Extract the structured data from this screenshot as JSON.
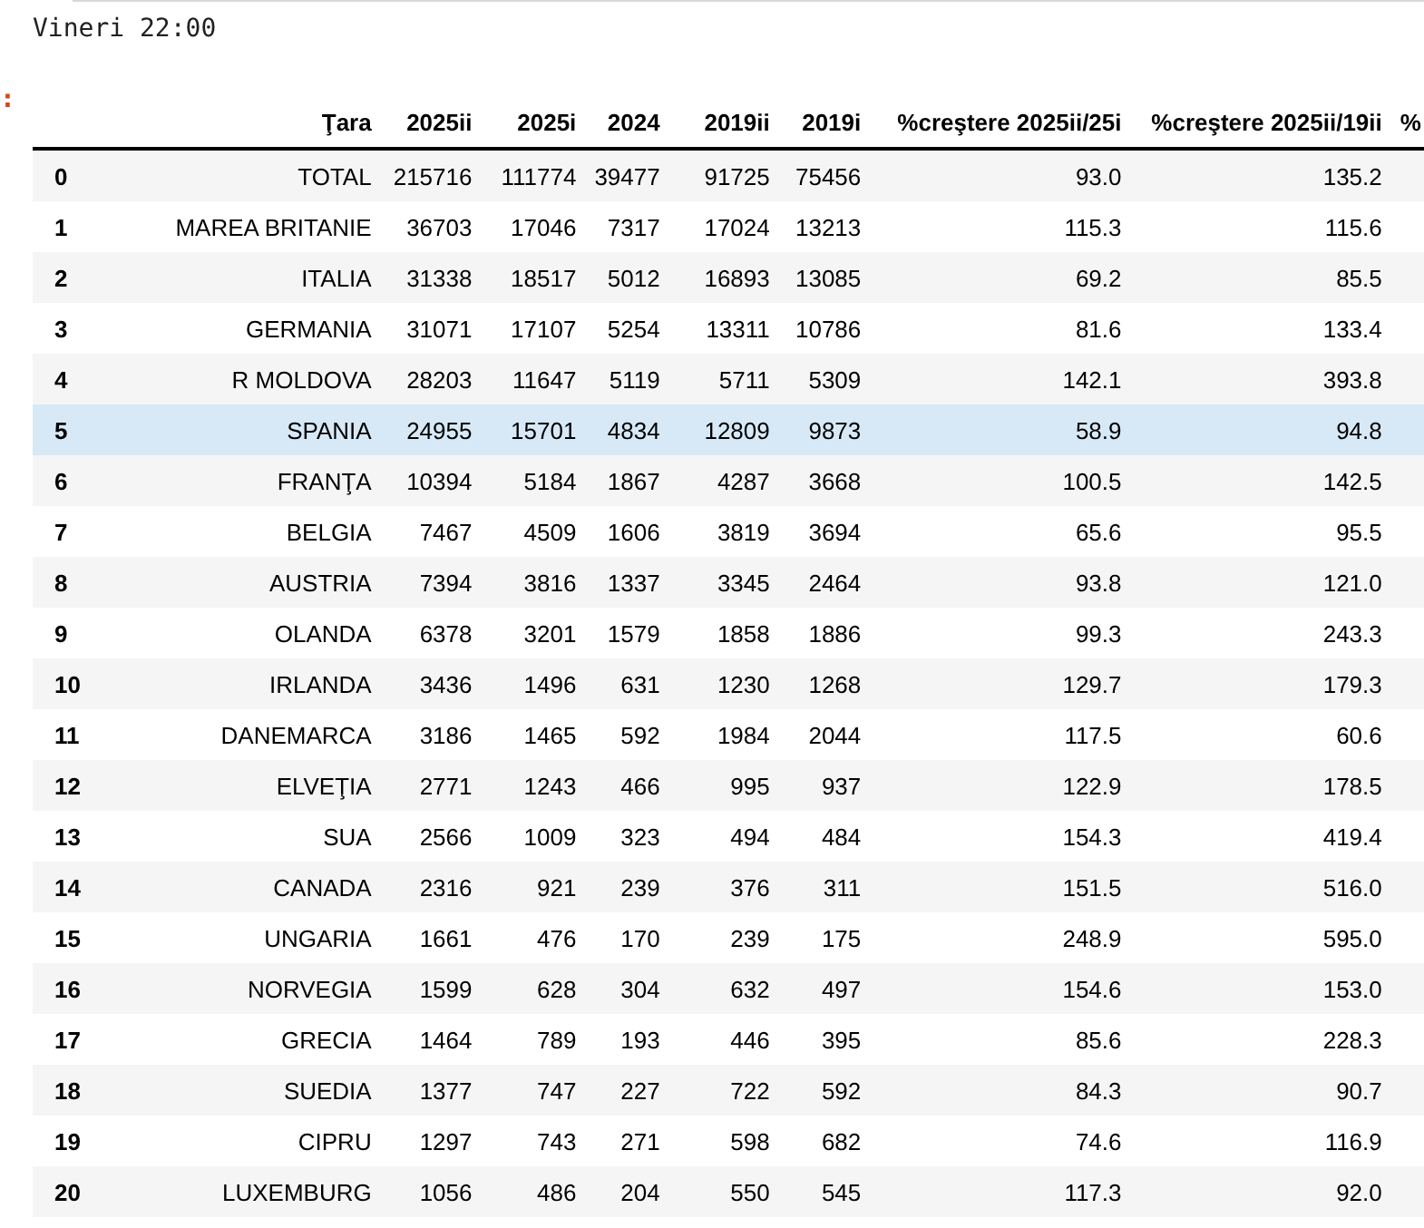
{
  "cell": {
    "output": "Vineri 22:00",
    "prompt": ":"
  },
  "table": {
    "columns": [
      "Ţara",
      "2025ii",
      "2025i",
      "2024",
      "2019ii",
      "2019i",
      "%creştere 2025ii/25i",
      "%creştere 2025ii/19ii",
      "%"
    ],
    "rows": [
      {
        "index": "0",
        "cells": [
          "TOTAL",
          "215716",
          "111774",
          "39477",
          "91725",
          "75456",
          "93.0",
          "135.2"
        ],
        "highlighted": false
      },
      {
        "index": "1",
        "cells": [
          "MAREA BRITANIE",
          "36703",
          "17046",
          "7317",
          "17024",
          "13213",
          "115.3",
          "115.6"
        ],
        "highlighted": false
      },
      {
        "index": "2",
        "cells": [
          "ITALIA",
          "31338",
          "18517",
          "5012",
          "16893",
          "13085",
          "69.2",
          "85.5"
        ],
        "highlighted": false
      },
      {
        "index": "3",
        "cells": [
          "GERMANIA",
          "31071",
          "17107",
          "5254",
          "13311",
          "10786",
          "81.6",
          "133.4"
        ],
        "highlighted": false
      },
      {
        "index": "4",
        "cells": [
          "R MOLDOVA",
          "28203",
          "11647",
          "5119",
          "5711",
          "5309",
          "142.1",
          "393.8"
        ],
        "highlighted": false
      },
      {
        "index": "5",
        "cells": [
          "SPANIA",
          "24955",
          "15701",
          "4834",
          "12809",
          "9873",
          "58.9",
          "94.8"
        ],
        "highlighted": true
      },
      {
        "index": "6",
        "cells": [
          "FRANŢA",
          "10394",
          "5184",
          "1867",
          "4287",
          "3668",
          "100.5",
          "142.5"
        ],
        "highlighted": false
      },
      {
        "index": "7",
        "cells": [
          "BELGIA",
          "7467",
          "4509",
          "1606",
          "3819",
          "3694",
          "65.6",
          "95.5"
        ],
        "highlighted": false
      },
      {
        "index": "8",
        "cells": [
          "AUSTRIA",
          "7394",
          "3816",
          "1337",
          "3345",
          "2464",
          "93.8",
          "121.0"
        ],
        "highlighted": false
      },
      {
        "index": "9",
        "cells": [
          "OLANDA",
          "6378",
          "3201",
          "1579",
          "1858",
          "1886",
          "99.3",
          "243.3"
        ],
        "highlighted": false
      },
      {
        "index": "10",
        "cells": [
          "IRLANDA",
          "3436",
          "1496",
          "631",
          "1230",
          "1268",
          "129.7",
          "179.3"
        ],
        "highlighted": false
      },
      {
        "index": "11",
        "cells": [
          "DANEMARCA",
          "3186",
          "1465",
          "592",
          "1984",
          "2044",
          "117.5",
          "60.6"
        ],
        "highlighted": false
      },
      {
        "index": "12",
        "cells": [
          "ELVEŢIA",
          "2771",
          "1243",
          "466",
          "995",
          "937",
          "122.9",
          "178.5"
        ],
        "highlighted": false
      },
      {
        "index": "13",
        "cells": [
          "SUA",
          "2566",
          "1009",
          "323",
          "494",
          "484",
          "154.3",
          "419.4"
        ],
        "highlighted": false
      },
      {
        "index": "14",
        "cells": [
          "CANADA",
          "2316",
          "921",
          "239",
          "376",
          "311",
          "151.5",
          "516.0"
        ],
        "highlighted": false
      },
      {
        "index": "15",
        "cells": [
          "UNGARIA",
          "1661",
          "476",
          "170",
          "239",
          "175",
          "248.9",
          "595.0"
        ],
        "highlighted": false
      },
      {
        "index": "16",
        "cells": [
          "NORVEGIA",
          "1599",
          "628",
          "304",
          "632",
          "497",
          "154.6",
          "153.0"
        ],
        "highlighted": false
      },
      {
        "index": "17",
        "cells": [
          "GRECIA",
          "1464",
          "789",
          "193",
          "446",
          "395",
          "85.6",
          "228.3"
        ],
        "highlighted": false
      },
      {
        "index": "18",
        "cells": [
          "SUEDIA",
          "1377",
          "747",
          "227",
          "722",
          "592",
          "84.3",
          "90.7"
        ],
        "highlighted": false
      },
      {
        "index": "19",
        "cells": [
          "CIPRU",
          "1297",
          "743",
          "271",
          "598",
          "682",
          "74.6",
          "116.9"
        ],
        "highlighted": false
      },
      {
        "index": "20",
        "cells": [
          "LUXEMBURG",
          "1056",
          "486",
          "204",
          "550",
          "545",
          "117.3",
          "92.0"
        ],
        "highlighted": false
      }
    ]
  }
}
